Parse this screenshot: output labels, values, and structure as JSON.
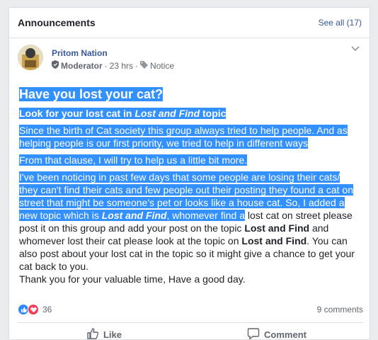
{
  "card": {
    "title": "Announcements",
    "see_all": "See all (17)"
  },
  "post": {
    "author": "Pritom Nation",
    "role": "Moderator",
    "time": "23 hrs",
    "tag": "Notice",
    "title": "Have you lost your cat?",
    "subtitle_prefix": "Look for your lost cat in ",
    "subtitle_bold": "Lost and Find",
    "subtitle_suffix": " topic",
    "para1": "Since the birth of Cat society this group always tried to help people. And as helping people is our first priority, we tried to help in different ways",
    "para2": "From that clause, I will try to help us a little bit more.",
    "para3_hl_a": " I've been noticing in past few days that some people are losing their cats/ they can't find their cats and few people out their posting they found a cat on street that might be someone's pet or looks like a house cat. So, I added a new topic which is ",
    "para3_hl_bold": "Lost and Find",
    "para3_hl_b": ", whomever find a",
    "para3_rest_a": " lost cat on street please post it on this group and add your post on the topic ",
    "para3_bold2": "Lost and Find",
    "para3_rest_b": " and whomever lost their cat please look at the topic on ",
    "para3_bold3": "Lost and Find",
    "para3_rest_c": ". You can also post about your lost cat in the topic so it might give a chance to get your cat back to you.",
    "closing": "Thank you for your valuable time, Have a good day."
  },
  "reactions": {
    "count": "36",
    "comments": "9 comments"
  },
  "actions": {
    "like": "Like",
    "comment": "Comment"
  },
  "icons": {
    "shield": "shield-icon",
    "tag": "tag-icon",
    "chevron": "chevron-down-icon",
    "like": "thumbs-up-icon",
    "comment": "comment-icon"
  },
  "colors": {
    "link": "#385898",
    "highlight": "#3390ff",
    "like": "#2d88ff",
    "love": "#f33e58"
  }
}
